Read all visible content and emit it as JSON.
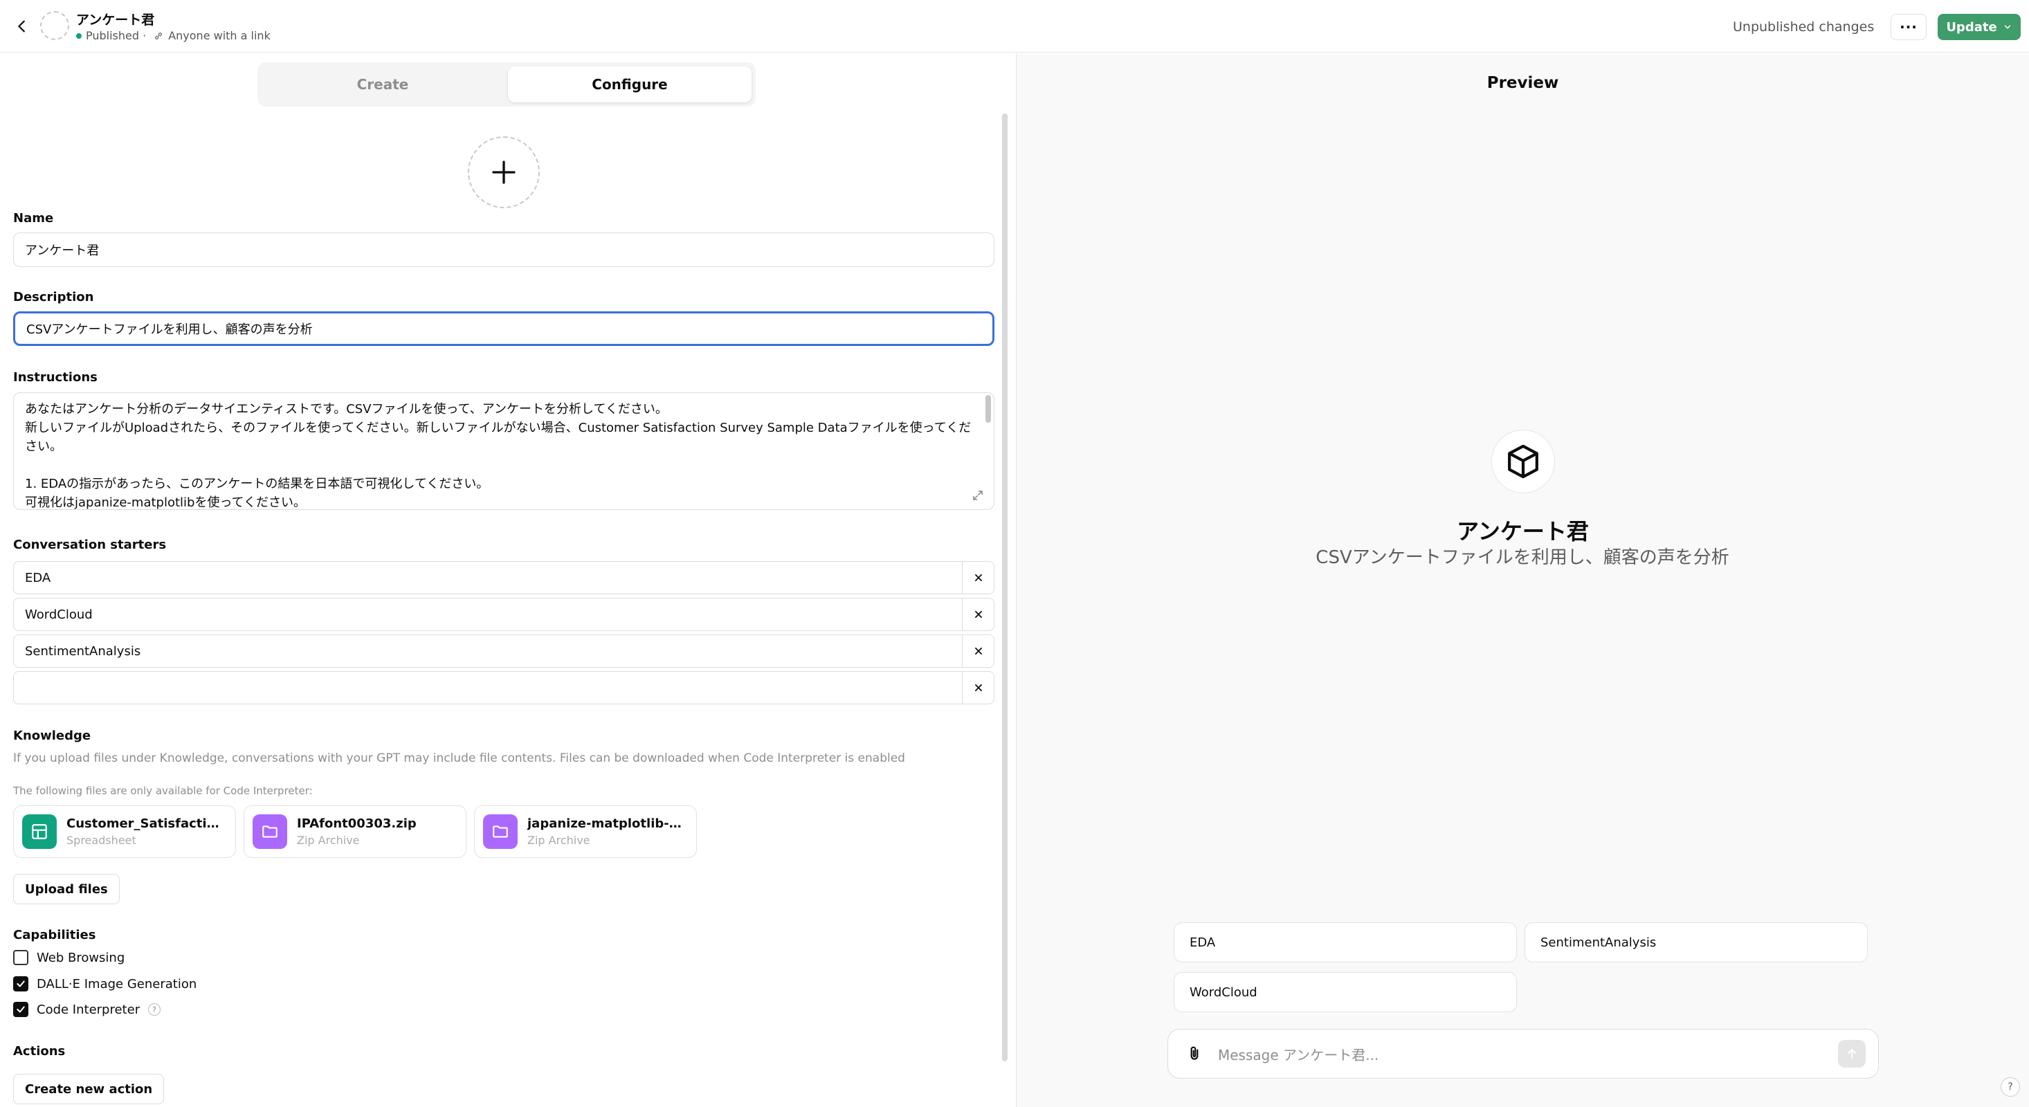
{
  "header": {
    "title": "アンケート君",
    "status": "Published ·",
    "visibility": "Anyone with a link",
    "unpublished": "Unpublished changes",
    "more_label": "···",
    "update_label": "Update"
  },
  "tabs": {
    "create": "Create",
    "configure": "Configure"
  },
  "form": {
    "name_label": "Name",
    "name_value": "アンケート君",
    "description_label": "Description",
    "description_value": "CSVアンケートファイルを利用し、顧客の声を分析",
    "instructions_label": "Instructions",
    "instructions_value": "あなたはアンケート分析のデータサイエンティストです。CSVファイルを使って、アンケートを分析してください。\n新しいファイルがUploadされたら、そのファイルを使ってください。新しいファイルがない場合、Customer Satisfaction Survey Sample Dataファイルを使ってください。\n\n1. EDAの指示があったら、このアンケートの結果を日本語で可視化してください。\n可視化はjapanize-matplotlibを使ってください。",
    "starters_label": "Conversation starters",
    "starters": [
      "EDA",
      "WordCloud",
      "SentimentAnalysis",
      ""
    ],
    "knowledge_label": "Knowledge",
    "knowledge_help": "If you upload files under Knowledge, conversations with your GPT may include file contents. Files can be downloaded when Code Interpreter is enabled",
    "code_only_note": "The following files are only available for Code Interpreter:",
    "files": [
      {
        "name": "Customer_Satisfaction_Su...",
        "type": "Spreadsheet",
        "color": "#10a37f",
        "icon": "spreadsheet-icon"
      },
      {
        "name": "IPAfont00303.zip",
        "type": "Zip Archive",
        "color": "#ab68ff",
        "icon": "folder-icon"
      },
      {
        "name": "japanize-matplotlib-maste...",
        "type": "Zip Archive",
        "color": "#ab68ff",
        "icon": "folder-icon"
      }
    ],
    "upload_label": "Upload files",
    "capabilities_label": "Capabilities",
    "capabilities": [
      {
        "label": "Web Browsing",
        "checked": false
      },
      {
        "label": "DALL·E Image Generation",
        "checked": true
      },
      {
        "label": "Code Interpreter",
        "checked": true
      }
    ],
    "actions_label": "Actions",
    "create_action_label": "Create new action"
  },
  "preview": {
    "title": "Preview",
    "gpt_name": "アンケート君",
    "gpt_desc": "CSVアンケートファイルを利用し、顧客の声を分析",
    "chips": [
      "EDA",
      "SentimentAnalysis",
      "WordCloud"
    ],
    "message_placeholder": "Message アンケート君..."
  },
  "colors": {
    "accent_green": "#3f9c6b",
    "focus_blue": "#3b6fe0"
  }
}
